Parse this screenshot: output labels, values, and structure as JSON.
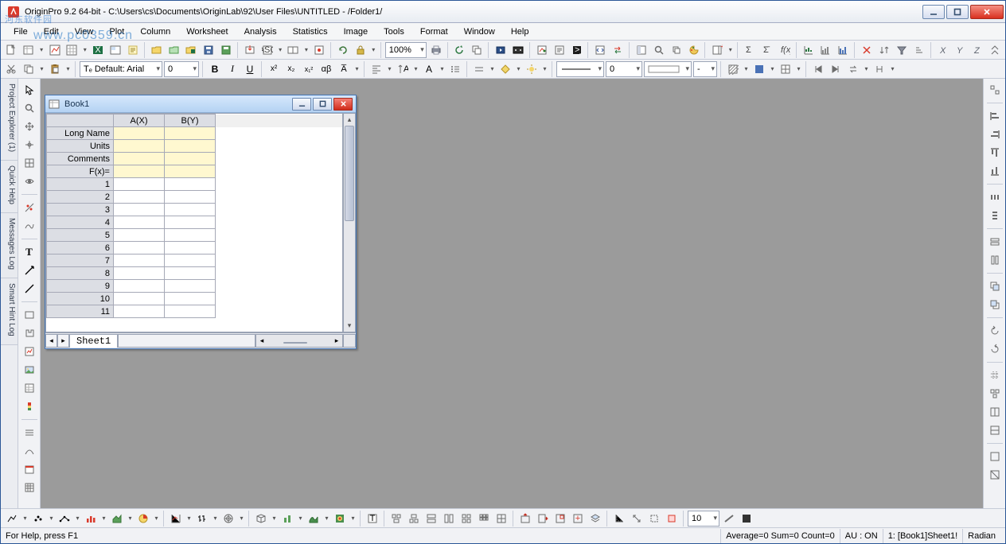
{
  "title": "OriginPro 9.2 64-bit - C:\\Users\\cs\\Documents\\OriginLab\\92\\User Files\\UNTITLED - /Folder1/",
  "menus": [
    "File",
    "Edit",
    "View",
    "Plot",
    "Column",
    "Worksheet",
    "Analysis",
    "Statistics",
    "Image",
    "Tools",
    "Format",
    "Window",
    "Help"
  ],
  "zoom": "100%",
  "font_selector": "Tₑ Default: Arial",
  "font_size": "0",
  "default_dd": "-",
  "dock_tabs": [
    "Project Explorer (1)",
    "Quick Help",
    "Messages Log",
    "Smart Hint Log"
  ],
  "book": {
    "title": "Book1",
    "columns": [
      "A(X)",
      "B(Y)"
    ],
    "labels": [
      "Long Name",
      "Units",
      "Comments",
      "F(x)="
    ],
    "rowcount": 11,
    "sheet_tab": "Sheet1"
  },
  "bottom_width": "10",
  "status": {
    "help": "For Help, press F1",
    "avg": "Average=0 Sum=0 Count=0",
    "au": "AU : ON",
    "sheet": "1: [Book1]Sheet1!",
    "angle": "Radian"
  }
}
